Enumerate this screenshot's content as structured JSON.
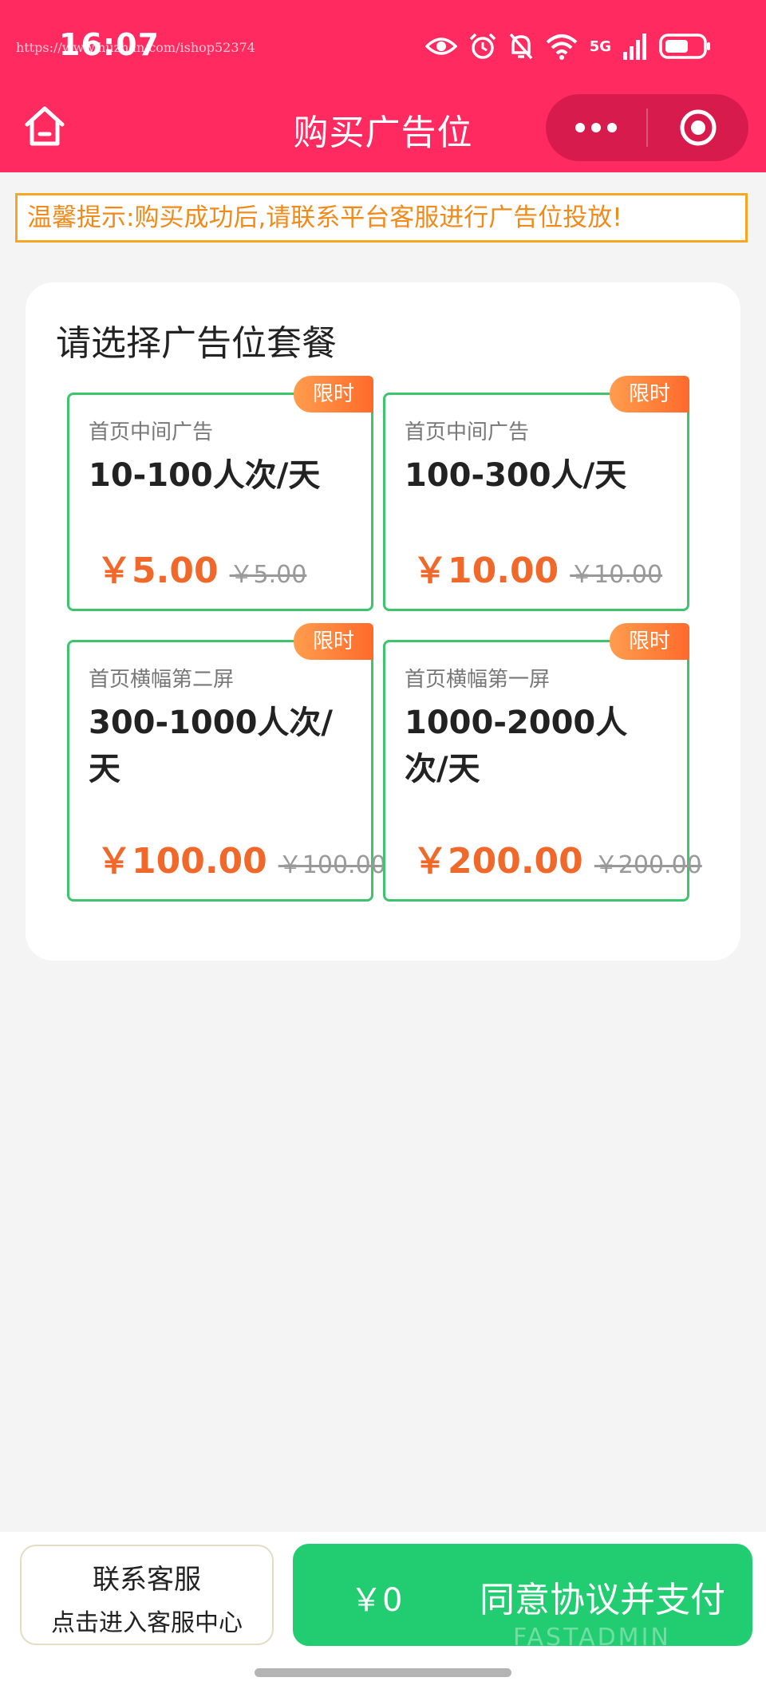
{
  "status_bar": {
    "time": "16:07",
    "watermark_url": "https://www.huzhan.com/ishop52374",
    "network": "5G",
    "icons": [
      "eye-icon",
      "alarm-icon",
      "bell-off-icon",
      "wifi-icon",
      "signal-icon",
      "battery-icon"
    ]
  },
  "nav": {
    "title": "购买广告位",
    "home_icon": "home-icon",
    "more_icon": "more-dots-icon",
    "close_icon": "target-icon"
  },
  "notice": {
    "text": "温馨提示:购买成功后,请联系平台客服进行广告位投放!"
  },
  "packages_section": {
    "title": "请选择广告位套餐",
    "items": [
      {
        "badge": "限时",
        "position": "首页中间广告",
        "traffic": "10-100人次/天",
        "price": "￥5.00",
        "original_price": "￥5.00"
      },
      {
        "badge": "限时",
        "position": "首页中间广告",
        "traffic": "100-300人/天",
        "price": "￥10.00",
        "original_price": "￥10.00"
      },
      {
        "badge": "限时",
        "position": "首页横幅第二屏",
        "traffic": "300-1000人次/天",
        "price": "￥100.00",
        "original_price": "￥100.00"
      },
      {
        "badge": "限时",
        "position": "首页横幅第一屏",
        "traffic": "1000-2000人次/天",
        "price": "￥200.00",
        "original_price": "￥200.00"
      }
    ]
  },
  "bottom_bar": {
    "service_line1": "联系客服",
    "service_line2": "点击进入客服中心",
    "pay_amount": "￥0",
    "pay_label": "同意协议并支付",
    "brand_watermark": "FASTADMIN"
  },
  "colors": {
    "header": "#ff2a5f",
    "accent_green": "#22cc71",
    "price_orange": "#f0692b",
    "notice_orange": "#f5a623"
  }
}
